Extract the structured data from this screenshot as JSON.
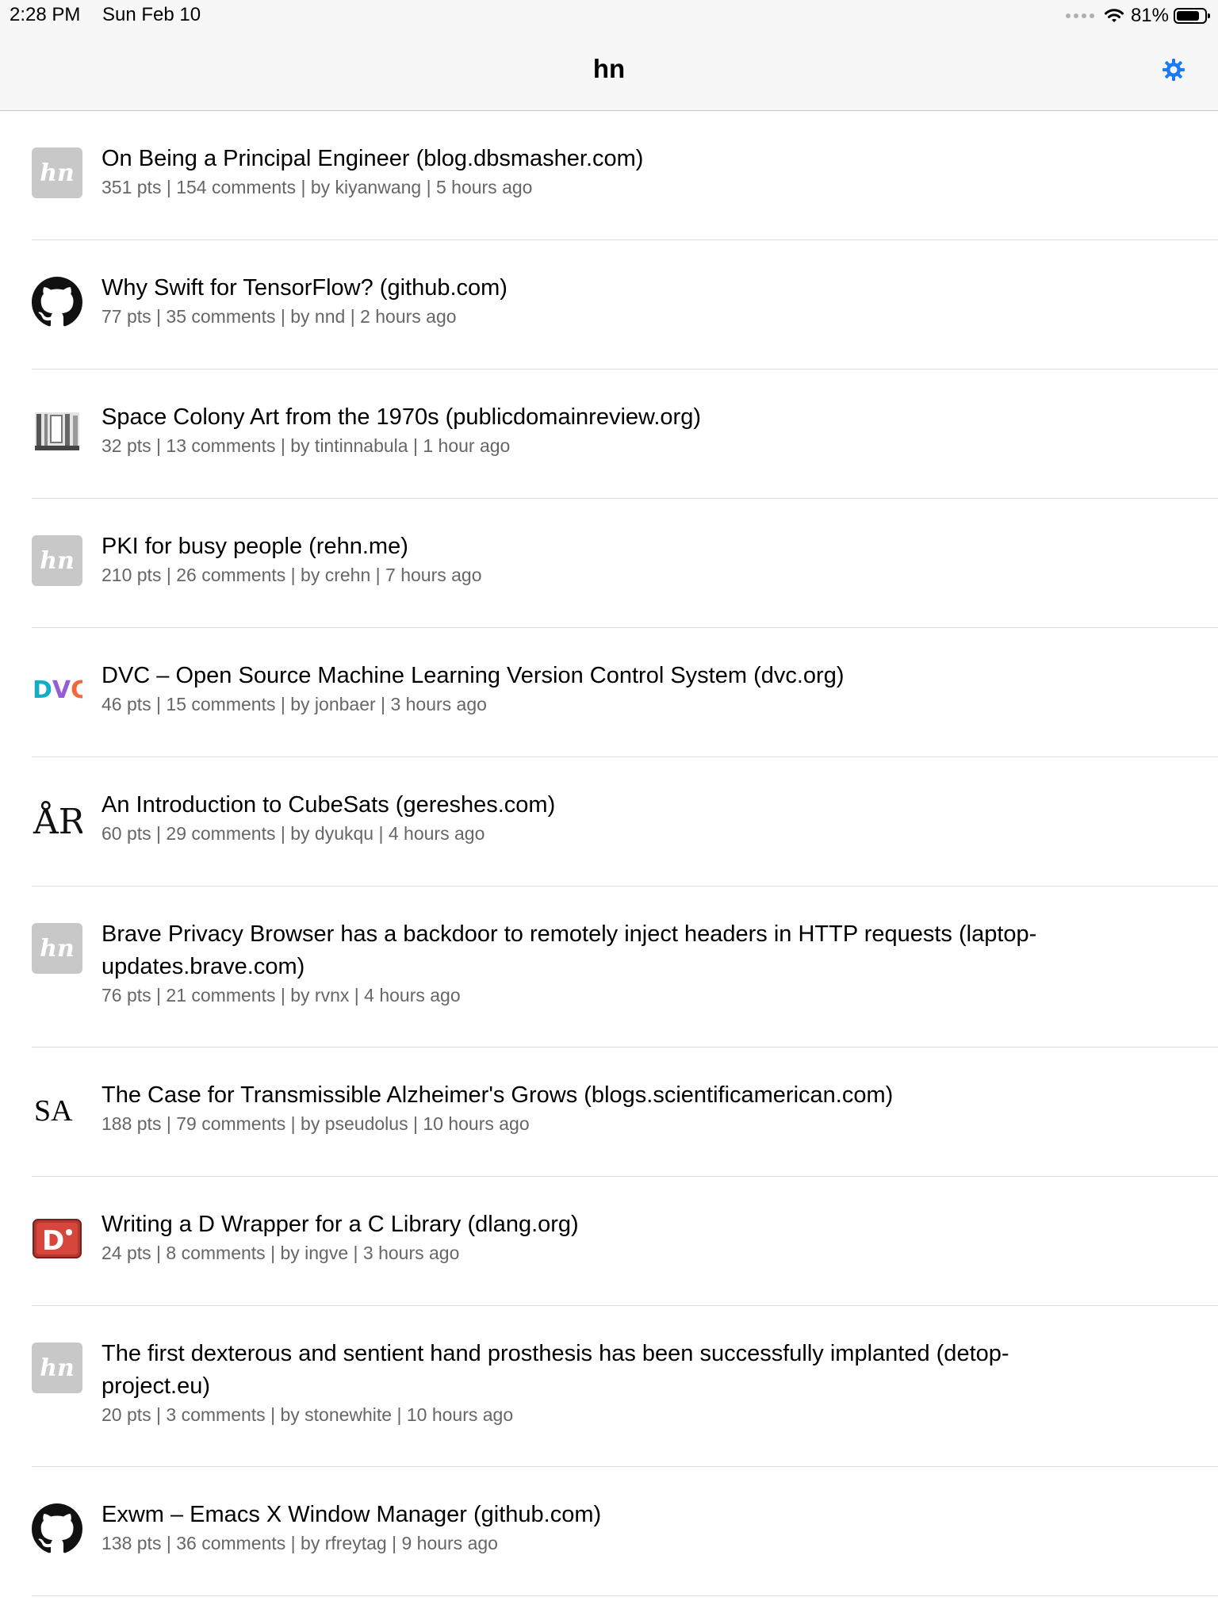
{
  "status_bar": {
    "time": "2:28 PM",
    "date": "Sun Feb 10",
    "battery_percent": "81%",
    "battery_level": 0.81
  },
  "nav": {
    "title": "hn",
    "settings_icon": "gear-icon",
    "accent_color": "#1a7cf0"
  },
  "stories": [
    {
      "title": "On Being a Principal Engineer (blog.dbsmasher.com)",
      "points": "351 pts",
      "comments": "154 comments",
      "by": "by kiyanwang",
      "age": "5 hours ago",
      "icon": "hn-placeholder-icon"
    },
    {
      "title": "Why Swift for TensorFlow? (github.com)",
      "points": "77 pts",
      "comments": "35 comments",
      "by": "by nnd",
      "age": "2 hours ago",
      "icon": "github-icon"
    },
    {
      "title": "Space Colony Art from the 1970s (publicdomainreview.org)",
      "points": "32 pts",
      "comments": "13 comments",
      "by": "by tintinnabula",
      "age": "1 hour ago",
      "icon": "public-domain-review-icon"
    },
    {
      "title": "PKI for busy people (rehn.me)",
      "points": "210 pts",
      "comments": "26 comments",
      "by": "by crehn",
      "age": "7 hours ago",
      "icon": "hn-placeholder-icon"
    },
    {
      "title": "DVC – Open Source Machine Learning Version Control System (dvc.org)",
      "points": "46 pts",
      "comments": "15 comments",
      "by": "by jonbaer",
      "age": "3 hours ago",
      "icon": "dvc-logo-icon"
    },
    {
      "title": "An Introduction to CubeSats (gereshes.com)",
      "points": "60 pts",
      "comments": "29 comments",
      "by": "by dyukqu",
      "age": "4 hours ago",
      "icon": "gereshes-logo-icon"
    },
    {
      "title": "Brave Privacy Browser has a backdoor to remotely inject headers in HTTP requests (laptop-updates.brave.com)",
      "points": "76 pts",
      "comments": "21 comments",
      "by": "by rvnx",
      "age": "4 hours ago",
      "icon": "hn-placeholder-icon"
    },
    {
      "title": "The Case for Transmissible Alzheimer's Grows (blogs.scientificamerican.com)",
      "points": "188 pts",
      "comments": "79 comments",
      "by": "by pseudolus",
      "age": "10 hours ago",
      "icon": "scientific-american-icon"
    },
    {
      "title": "Writing a D Wrapper for a C Library (dlang.org)",
      "points": "24 pts",
      "comments": "8 comments",
      "by": "by ingve",
      "age": "3 hours ago",
      "icon": "dlang-logo-icon"
    },
    {
      "title": "The first dexterous and sentient hand prosthesis has been successfully implanted (detop-project.eu)",
      "points": "20 pts",
      "comments": "3 comments",
      "by": "by stonewhite",
      "age": "10 hours ago",
      "icon": "hn-placeholder-icon"
    },
    {
      "title": "Exwm – Emacs X Window Manager (github.com)",
      "points": "138 pts",
      "comments": "36 comments",
      "by": "by rfreytag",
      "age": "9 hours ago",
      "icon": "github-icon"
    }
  ],
  "placeholder_label": "hn",
  "logo_text": {
    "dvc": "DVC",
    "gereshes": "ÅR",
    "scientific_american": "SA",
    "dlang": "D"
  }
}
